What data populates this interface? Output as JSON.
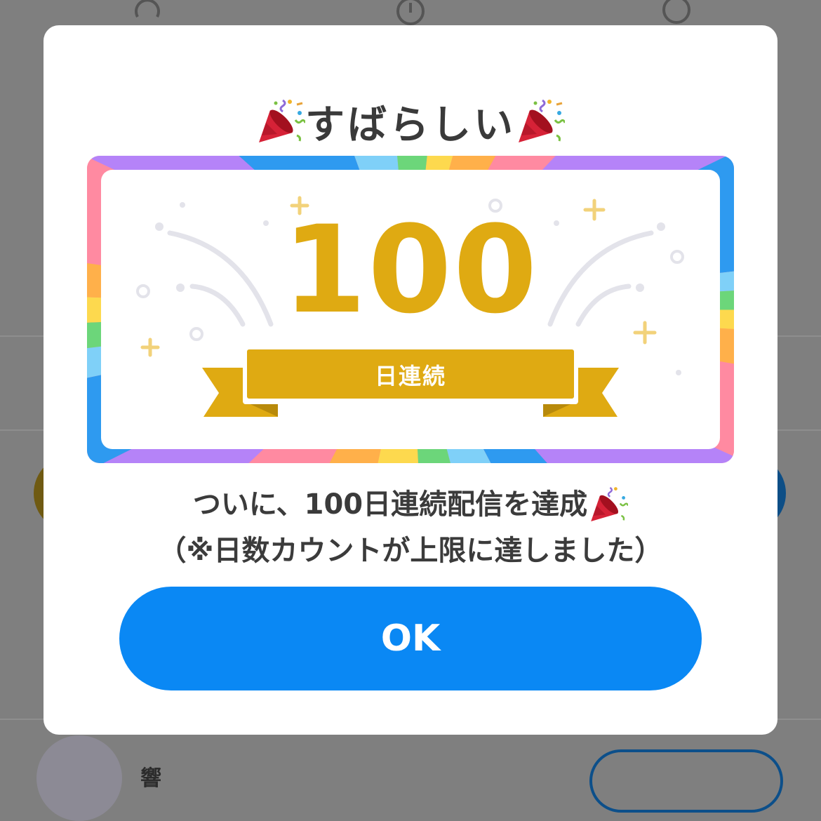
{
  "dialog": {
    "title": "すばらしい",
    "badge": {
      "count": "100",
      "ribbon_label": "日連続"
    },
    "message_line1": "ついに、100日連続配信を達成",
    "message_line2": "（※日数カウントが上限に達しました）",
    "ok_label": "OK"
  },
  "background": {
    "user_name": "響"
  },
  "colors": {
    "gold": "#dfaa12",
    "button_blue": "#0a88f4",
    "overlay": "#7f7f7f"
  }
}
